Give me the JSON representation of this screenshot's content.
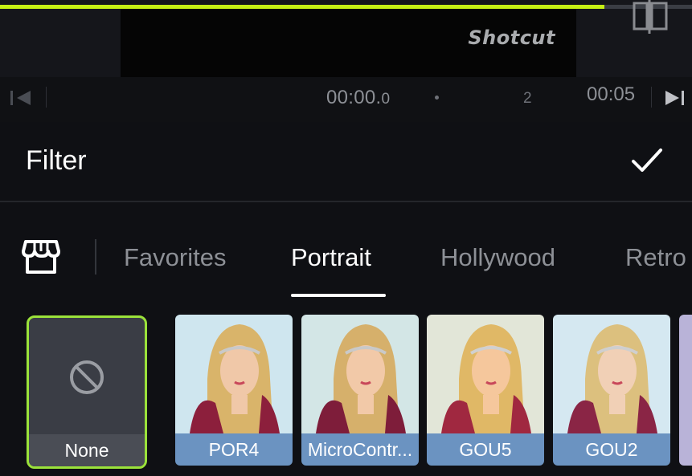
{
  "preview": {
    "watermark": "Shotcut",
    "progress_fraction": 0.873,
    "colors": {
      "progress": "#c6f014"
    }
  },
  "timeline": {
    "current_time_main": "00:00.",
    "current_time_small": "0",
    "tick_label": "2",
    "end_time": "00:05"
  },
  "header": {
    "title": "Filter",
    "confirm_icon": "check-icon"
  },
  "tabs": {
    "store_icon": "store-icon",
    "items": [
      {
        "label": "Favorites",
        "active": false
      },
      {
        "label": "Portrait",
        "active": true
      },
      {
        "label": "Hollywood",
        "active": false
      },
      {
        "label": "Retro",
        "active": false
      }
    ]
  },
  "filters": [
    {
      "label": "None",
      "selected": true,
      "icon": "no-filter-icon"
    },
    {
      "label": "POR4",
      "selected": false
    },
    {
      "label": "MicroContr...",
      "selected": false
    },
    {
      "label": "GOU5",
      "selected": false
    },
    {
      "label": "GOU2",
      "selected": false
    }
  ],
  "colors": {
    "accent_green": "#9be23a",
    "label_blue": "#6b93c1",
    "background": "#0f1014"
  }
}
